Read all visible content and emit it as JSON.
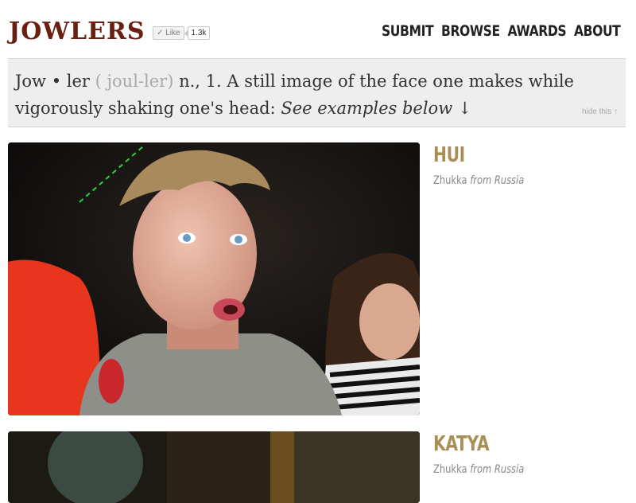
{
  "header": {
    "logo": "JOWLERS",
    "like_label": "✓ Like",
    "like_count": "1.3k",
    "nav": [
      "SUBMIT",
      "BROWSE",
      "AWARDS",
      "ABOUT"
    ]
  },
  "banner": {
    "word": "Jow • ler",
    "pronunciation": "( joul-ler)",
    "part_of_speech": "n.,",
    "sense_number": "1.",
    "definition": "A still image of the face one makes while vigorously shaking one's head:",
    "see_examples": "See examples below ↓",
    "hide_label": "hide this ↑"
  },
  "entries": [
    {
      "name": "HUI",
      "author": "Zhukka",
      "from_label": "from",
      "country": "Russia"
    },
    {
      "name": "KATYA",
      "author": "Zhukka",
      "from_label": "from",
      "country": "Russia"
    }
  ],
  "colors": {
    "logo": "#6b1f10",
    "entry_name": "#a88f55",
    "banner_bg": "#eeeeee"
  }
}
